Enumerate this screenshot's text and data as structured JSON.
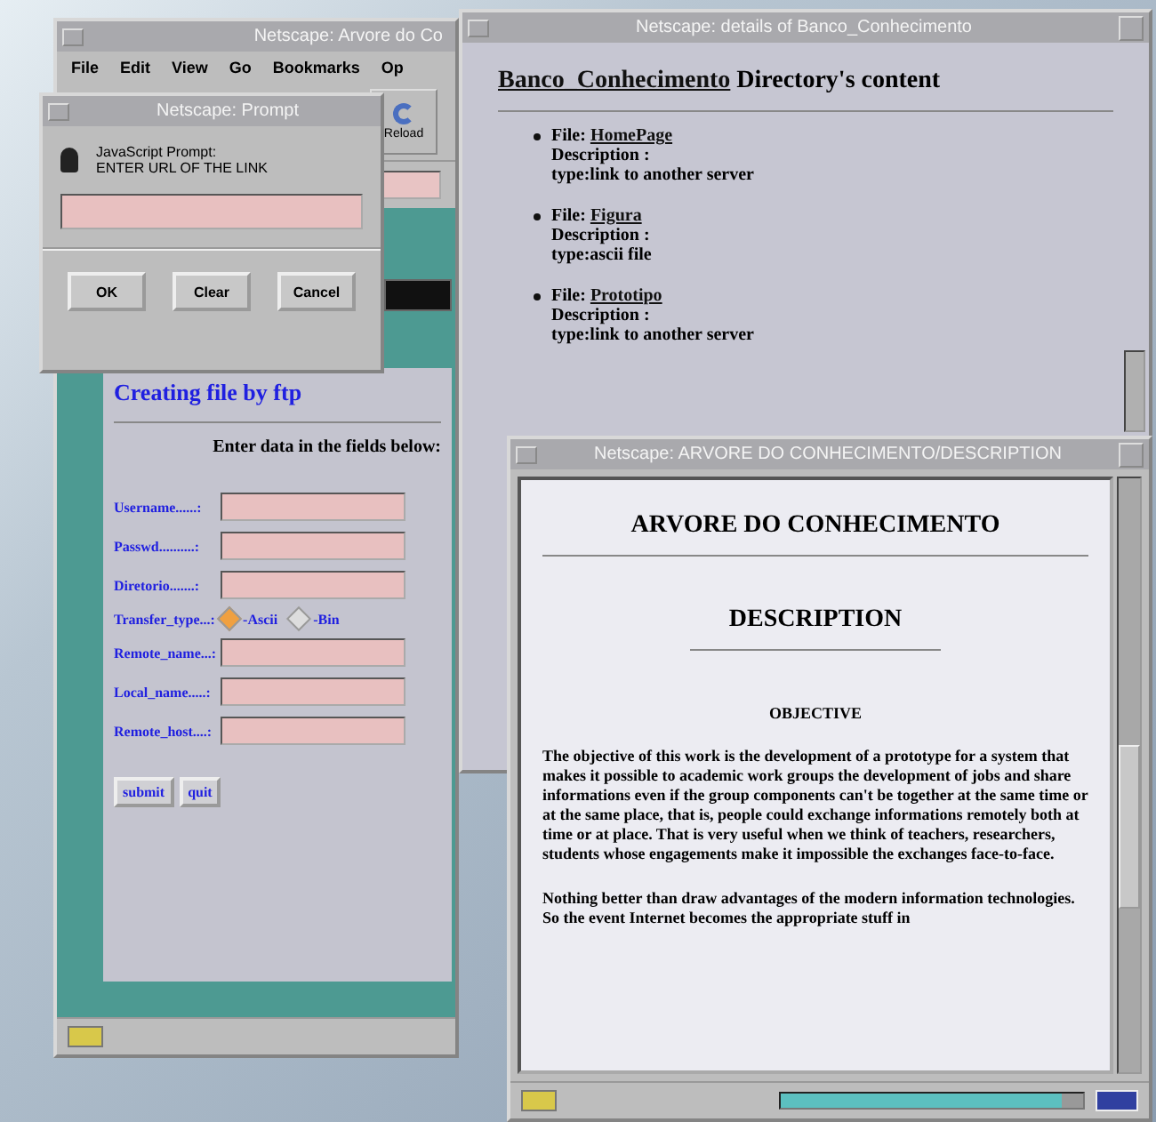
{
  "main_window": {
    "title": "Netscape: Arvore do Co",
    "menu": [
      "File",
      "Edit",
      "View",
      "Go",
      "Bookmarks",
      "Op"
    ],
    "toolbar_button": "Reload",
    "page": {
      "heading": "Creating file by ftp",
      "instruction": "Enter data in the fields below:",
      "fields": [
        {
          "kind": "text",
          "label": "Username......:"
        },
        {
          "kind": "text",
          "label": "Passwd..........:"
        },
        {
          "kind": "text",
          "label": "Diretorio.......:"
        },
        {
          "kind": "radio",
          "label": "Transfer_type...:",
          "options": [
            {
              "label": "-Ascii",
              "selected": true
            },
            {
              "label": "-Bin",
              "selected": false
            }
          ]
        },
        {
          "kind": "text",
          "label": "Remote_name...:"
        },
        {
          "kind": "text",
          "label": "Local_name.....:"
        },
        {
          "kind": "text",
          "label": "Remote_host....:"
        }
      ],
      "buttons": [
        "submit",
        "quit"
      ]
    }
  },
  "prompt_dialog": {
    "title": "Netscape: Prompt",
    "message": [
      "JavaScript Prompt:",
      "ENTER URL OF THE LINK"
    ],
    "buttons": [
      "OK",
      "Clear",
      "Cancel"
    ]
  },
  "details_window": {
    "title": "Netscape: details of Banco_Conhecimento",
    "heading_link": "Banco_Conhecimento",
    "heading_rest": " Directory's content",
    "files": [
      {
        "label": "File: ",
        "name": "HomePage",
        "description": "Description :",
        "type": "type:link to another server"
      },
      {
        "label": "File: ",
        "name": "Figura",
        "description": "Description :",
        "type": "type:ascii file"
      },
      {
        "label": "File: ",
        "name": "Prototipo",
        "description": "Description :",
        "type": "type:link to another server"
      }
    ]
  },
  "description_window": {
    "title": "Netscape: ARVORE DO CONHECIMENTO/DESCRIPTION",
    "heading": "ARVORE DO CONHECIMENTO",
    "subheading": "DESCRIPTION",
    "section": "OBJECTIVE",
    "paragraphs": [
      "The objective of this work is the development of a prototype for a system that makes it possible to academic work groups the development of jobs and share informations even if the group components can't be together at the same time or at the same place, that is, people could exchange informations remotely both at time or at place. That is very useful when we think of teachers, researchers, students whose engagements make it impossible the exchanges face-to-face.",
      "Nothing better than draw advantages of the modern information technologies. So the event Internet becomes the appropriate stuff in"
    ],
    "progress": {
      "level": 0.93
    }
  }
}
